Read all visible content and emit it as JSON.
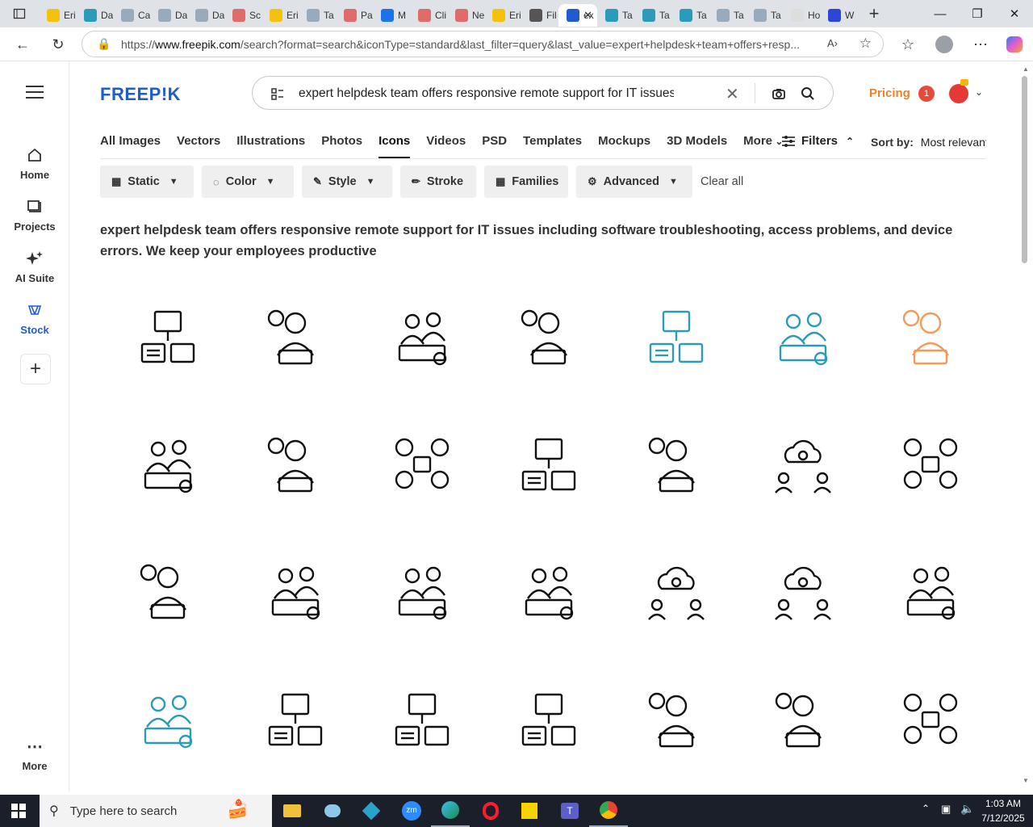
{
  "browser": {
    "tabs": [
      {
        "label": "Eri",
        "color": "#f4c20d"
      },
      {
        "label": "Da",
        "color": "#2a9bb8"
      },
      {
        "label": "Ca",
        "color": "#9ab"
      },
      {
        "label": "Da",
        "color": "#9ab"
      },
      {
        "label": "Da",
        "color": "#9ab"
      },
      {
        "label": "Sc",
        "color": "#e06b6b"
      },
      {
        "label": "Eri",
        "color": "#f4c20d"
      },
      {
        "label": "Ta",
        "color": "#9ab"
      },
      {
        "label": "Pa",
        "color": "#e06b6b"
      },
      {
        "label": "M",
        "color": "#1a73e8"
      },
      {
        "label": "Cli",
        "color": "#e06b6b"
      },
      {
        "label": "Ne",
        "color": "#e06b6b"
      },
      {
        "label": "Eri",
        "color": "#f4c20d"
      },
      {
        "label": "Fil",
        "color": "#555"
      },
      {
        "label": "ex",
        "color": "#1f5cce",
        "active": true
      },
      {
        "label": "Ta",
        "color": "#2a9bb8"
      },
      {
        "label": "Ta",
        "color": "#2a9bb8"
      },
      {
        "label": "Ta",
        "color": "#2a9bb8"
      },
      {
        "label": "Ta",
        "color": "#9ab"
      },
      {
        "label": "Ta",
        "color": "#9ab"
      },
      {
        "label": "Ho",
        "color": "#ddd"
      },
      {
        "label": "W",
        "color": "#2c47d8"
      }
    ],
    "url_prefix": "https://",
    "url_host": "www.freepik.com",
    "url_rest": "/search?format=search&iconType=standard&last_filter=query&last_value=expert+helpdesk+team+offers+resp..."
  },
  "sidebar": {
    "items": [
      {
        "label": "Home",
        "icon": "home-icon"
      },
      {
        "label": "Projects",
        "icon": "projects-icon"
      },
      {
        "label": "AI Suite",
        "icon": "sparkle-icon"
      },
      {
        "label": "Stock",
        "icon": "stock-icon"
      }
    ],
    "more_label": "More"
  },
  "header": {
    "logo": "FREEP!K",
    "search_query": "expert helpdesk team offers responsive remote support for IT issues inclu",
    "pricing_label": "Pricing",
    "notification_count": "1"
  },
  "categories": [
    "All Images",
    "Vectors",
    "Illustrations",
    "Photos",
    "Icons",
    "Videos",
    "PSD",
    "Templates",
    "Mockups",
    "3D Models",
    "More"
  ],
  "selected_category": "Icons",
  "filters_label": "Filters",
  "sort": {
    "label": "Sort by:",
    "value": "Most relevant"
  },
  "chips": {
    "static": "Static",
    "color": "Color",
    "style": "Style",
    "stroke": "Stroke",
    "families": "Families",
    "advanced": "Advanced",
    "clear": "Clear all"
  },
  "heading": "expert helpdesk team offers responsive remote support for IT issues including software troubleshooting, access problems, and device errors. We keep your employees productive",
  "results": [
    [
      "it-support-network-icon",
      "support-agent-screen-icon",
      "helpdesk-team-gear-icon",
      "headset-question-icon",
      "laptop-support-network-icon",
      "support-team-gear-icon",
      "support-agent-screen-icon-orange"
    ],
    [
      "support-desk-team-icon",
      "agent-mail-contacts-icon",
      "support-network-people-icon",
      "screens-agent-icon",
      "headset-agent-question-icon",
      "cloud-agents-icon",
      "people-network-question-icon"
    ],
    [
      "question-chair-icon",
      "agent-desk-info-icon",
      "chat-support-desk-icon",
      "support-team-gear-outline-icon",
      "cloud-network-agents-icon",
      "cloud-network-agents-icon-2",
      "agent-question-tools-icon"
    ],
    [
      "team-gear-color-icon",
      "monitor-agent-chat-icon",
      "monitor-headset-question-icon",
      "monitor-headset-question-icon-2",
      "laptop-brain-alert-icon",
      "agent-wrench-icon",
      "agents-info-icon"
    ]
  ],
  "colors": {
    "accent": "#1f5cce",
    "pricing": "#e9822d",
    "icon_default": "#111111",
    "icon_blue": "#2a9bb8",
    "icon_orange": "#f39a5a"
  },
  "taskbar": {
    "search_placeholder": "Type here to search",
    "time": "1:03 AM",
    "date": "7/12/2025"
  }
}
